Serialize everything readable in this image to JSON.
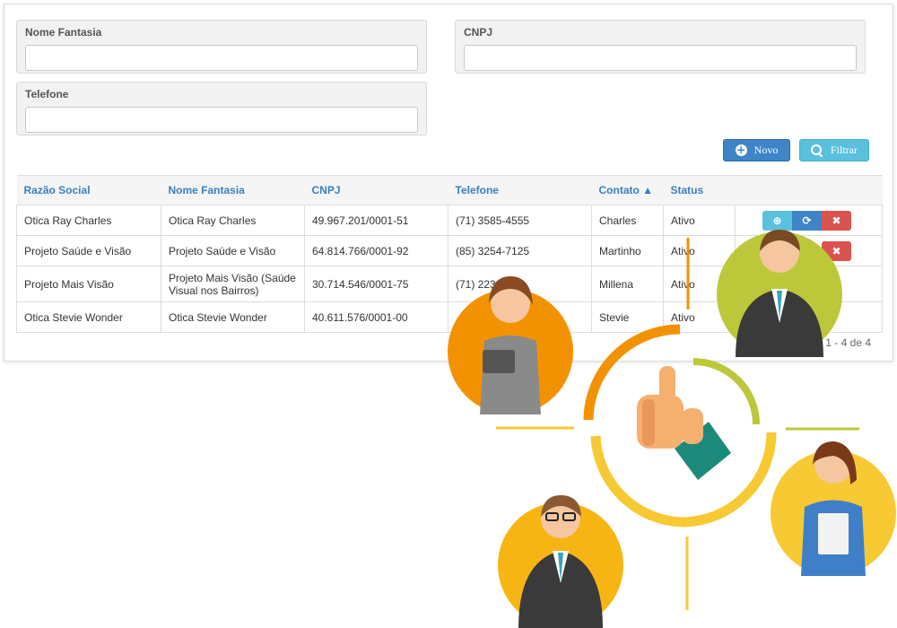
{
  "filters": {
    "nome_fantasia": {
      "label": "Nome Fantasia",
      "value": ""
    },
    "cnpj": {
      "label": "CNPJ",
      "value": ""
    },
    "telefone": {
      "label": "Telefone",
      "value": ""
    }
  },
  "buttons": {
    "novo": "Novo",
    "filtrar": "Filtrar"
  },
  "table": {
    "headers": [
      "Razão Social",
      "Nome Fantasia",
      "CNPJ",
      "Telefone",
      "Contato ▲",
      "Status"
    ],
    "rows": [
      {
        "razao": "Otica Ray Charles",
        "fantasia": "Otica Ray Charles",
        "cnpj": "49.967.201/0001-51",
        "telefone": "(71) 3585-4555",
        "contato": "Charles",
        "status": "Ativo"
      },
      {
        "razao": "Projeto Saúde e Visão",
        "fantasia": "Projeto Saúde e Visão",
        "cnpj": "64.814.766/0001-92",
        "telefone": "(85) 3254-7125",
        "contato": "Martinho",
        "status": "Ativo"
      },
      {
        "razao": "Projeto Mais Visão",
        "fantasia": "Projeto Mais Visão (Saúde Visual nos Bairros)",
        "cnpj": "30.714.546/0001-75",
        "telefone": "(71) 2233",
        "contato": "Millena",
        "status": "Ativo"
      },
      {
        "razao": "Otica Stevie Wonder",
        "fantasia": "Otica Stevie Wonder",
        "cnpj": "40.611.576/0001-00",
        "telefone": "",
        "contato": "Stevie",
        "status": "Ativo"
      }
    ]
  },
  "pager": "1 - 4 de 4",
  "colors": {
    "primary": "#3d85c6",
    "info": "#5bc0de",
    "danger": "#d9534f",
    "orange": "#f39200",
    "yellow": "#f7c933",
    "green": "#bcc83a"
  },
  "icons": [
    "plus-circle-icon",
    "search-icon",
    "zoom-in-icon",
    "refresh-icon",
    "close-icon"
  ]
}
